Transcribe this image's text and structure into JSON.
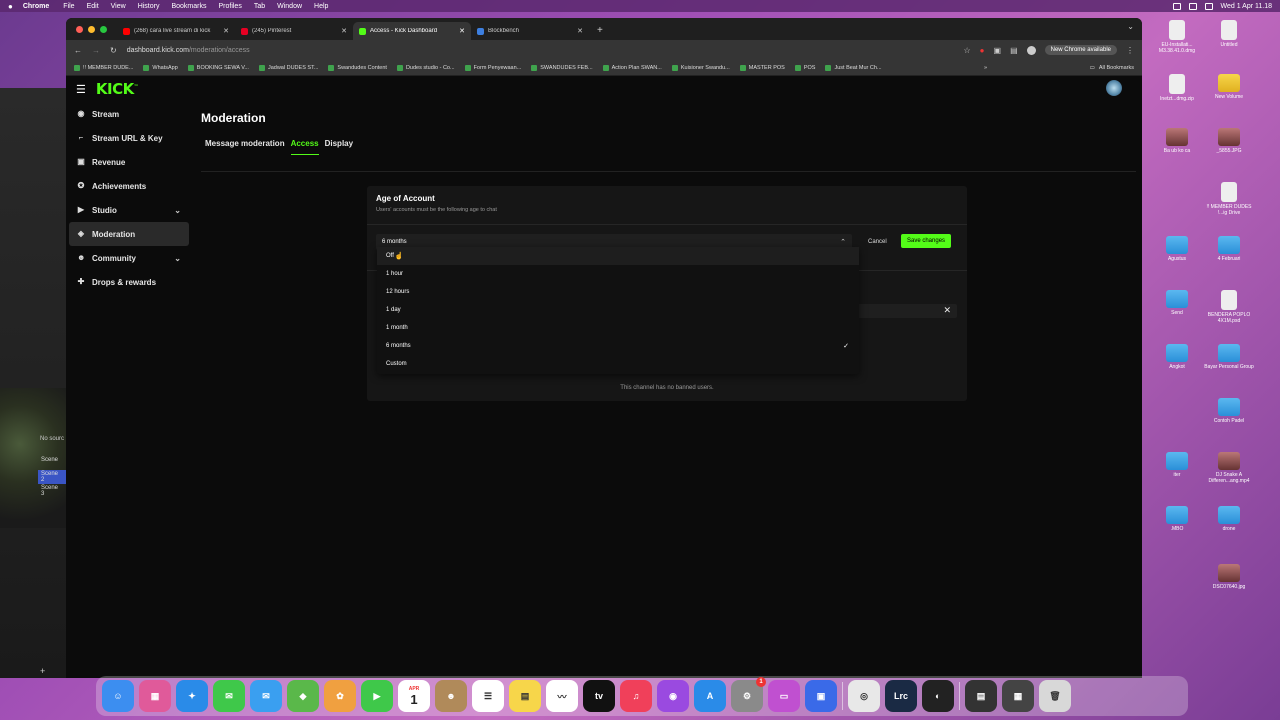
{
  "menubar": {
    "app_name": "Chrome",
    "items": [
      "File",
      "Edit",
      "View",
      "History",
      "Bookmarks",
      "Profiles",
      "Tab",
      "Window",
      "Help"
    ],
    "datetime": "Wed 1 Apr 11.18"
  },
  "obs": {
    "no_source": "No sourc",
    "scenes": [
      "Scene",
      "Scene 2",
      "Scene 3"
    ]
  },
  "browser": {
    "tabs": [
      {
        "title": "(268) cara live stream di kick",
        "color": "#ff0000"
      },
      {
        "title": "(245) Pinterest",
        "color": "#e60023"
      },
      {
        "title": "Access - Kick Dashboard",
        "color": "#53fc18"
      },
      {
        "title": "Blockbench",
        "color": "#3d7fe0"
      }
    ],
    "url_host": "dashboard.kick.com",
    "url_path": "/moderation/access",
    "update_label": "New Chrome available",
    "bookmarks": [
      "!! MEMBER DUDE...",
      "WhatsApp",
      "BOOKING SEWA V...",
      "Jadwal DUDES ST...",
      "Swandudes Content",
      "Dudes studio - Co...",
      "Form Penyewaan...",
      "SWANDUDES FEB...",
      "Action Plan SWAN...",
      "Kuisioner Swandu...",
      "MASTER POS",
      "POS",
      "Just Beat Mur Ch..."
    ],
    "all_bookmarks": "All Bookmarks"
  },
  "kick": {
    "logo": "KICK",
    "sidebar": [
      {
        "label": "Stream",
        "icon": "stream-icon",
        "chevron": false
      },
      {
        "label": "Stream URL & Key",
        "icon": "key-icon",
        "chevron": false
      },
      {
        "label": "Revenue",
        "icon": "revenue-icon",
        "chevron": false
      },
      {
        "label": "Achievements",
        "icon": "trophy-icon",
        "chevron": false
      },
      {
        "label": "Studio",
        "icon": "studio-icon",
        "chevron": true
      },
      {
        "label": "Moderation",
        "icon": "shield-icon",
        "chevron": false,
        "active": true
      },
      {
        "label": "Community",
        "icon": "community-icon",
        "chevron": true
      },
      {
        "label": "Drops & rewards",
        "icon": "gift-icon",
        "chevron": false
      }
    ],
    "page_title": "Moderation",
    "tabs": [
      {
        "label": "Message moderation",
        "active": false
      },
      {
        "label": "Access",
        "active": true
      },
      {
        "label": "Display",
        "active": false
      }
    ],
    "card": {
      "title": "Age of Account",
      "subtitle": "Users' accounts must be the following age to chat",
      "selected_value": "6 months",
      "cancel_label": "Cancel",
      "save_label": "Save changes",
      "empty_text": "This channel has no banned users."
    },
    "dropdown_options": [
      {
        "label": "Off",
        "hover": true,
        "selected": false
      },
      {
        "label": "1 hour",
        "hover": false,
        "selected": false
      },
      {
        "label": "12 hours",
        "hover": false,
        "selected": false
      },
      {
        "label": "1 day",
        "hover": false,
        "selected": false
      },
      {
        "label": "1 month",
        "hover": false,
        "selected": false
      },
      {
        "label": "6 months",
        "hover": false,
        "selected": true
      },
      {
        "label": "Custom",
        "hover": false,
        "selected": false
      }
    ],
    "accent_color": "#53fc18"
  },
  "desktop_icons": [
    {
      "label": "EU-Installati... M3.38.41.0.dmg",
      "type": "file"
    },
    {
      "label": "Untitled",
      "type": "file"
    },
    {
      "label": "New Volume",
      "type": "yellow"
    },
    {
      "label": "Inetzt...dmg.zip",
      "type": "file"
    },
    {
      "label": "_5855.JPG",
      "type": "img"
    },
    {
      "label": "Ba ub ko ca",
      "type": "img"
    },
    {
      "label": "!! MEMBER DUDES !...ig Drive",
      "type": "file"
    },
    {
      "label": "Agustus",
      "type": "folder"
    },
    {
      "label": "4 Februari",
      "type": "folder"
    },
    {
      "label": "Send",
      "type": "folder"
    },
    {
      "label": "BENDERA POPLO 4X1M.psd",
      "type": "file"
    },
    {
      "label": "Angkot",
      "type": "folder"
    },
    {
      "label": "Bayar Personal Group",
      "type": "folder"
    },
    {
      "label": "Contoh Padel",
      "type": "folder"
    },
    {
      "label": "iter",
      "type": "folder"
    },
    {
      "label": "DJ Snake A Differen...ang.mp4",
      "type": "img"
    },
    {
      "label": ".MBO",
      "type": "folder"
    },
    {
      "label": "drone",
      "type": "folder"
    },
    {
      "label": "DSC07640.jpg",
      "type": "img"
    }
  ],
  "dock": [
    {
      "name": "finder-icon",
      "color": "#3c8ef0",
      "glyph": "☺"
    },
    {
      "name": "launchpad-icon",
      "color": "#e05a9a",
      "glyph": "▦"
    },
    {
      "name": "safari-icon",
      "color": "#2a8be8",
      "glyph": "✦"
    },
    {
      "name": "messages-icon",
      "color": "#3fc84a",
      "glyph": "✉"
    },
    {
      "name": "mail-icon",
      "color": "#3a9ff0",
      "glyph": "✉"
    },
    {
      "name": "maps-icon",
      "color": "#5ab84a",
      "glyph": "◆"
    },
    {
      "name": "photos-icon",
      "color": "#f0a040",
      "glyph": "✿"
    },
    {
      "name": "facetime-icon",
      "color": "#3fc84a",
      "glyph": "▶"
    },
    {
      "name": "calendar-icon",
      "color": "#ffffff",
      "glyph": "1"
    },
    {
      "name": "contacts-icon",
      "color": "#b08a5a",
      "glyph": "☻"
    },
    {
      "name": "reminders-icon",
      "color": "#ffffff",
      "glyph": "☰"
    },
    {
      "name": "notes-icon",
      "color": "#f7d64a",
      "glyph": "▤"
    },
    {
      "name": "freeform-icon",
      "color": "#ffffff",
      "glyph": "〰"
    },
    {
      "name": "appletv-icon",
      "color": "#111111",
      "glyph": "tv"
    },
    {
      "name": "music-icon",
      "color": "#f0405a",
      "glyph": "♫"
    },
    {
      "name": "podcasts-icon",
      "color": "#9a4ae0",
      "glyph": "◉"
    },
    {
      "name": "appstore-icon",
      "color": "#2a8be8",
      "glyph": "A"
    },
    {
      "name": "settings-icon",
      "color": "#8a8a8a",
      "glyph": "⚙"
    },
    {
      "name": "iphone-mirroring-icon",
      "color": "#c050d0",
      "glyph": "▭"
    },
    {
      "name": "app-icon",
      "color": "#3a6ae8",
      "glyph": "▣"
    },
    {
      "name": "chrome-icon",
      "color": "#e8e8e8",
      "glyph": "◎"
    },
    {
      "name": "lightroom-icon",
      "color": "#1a2a44",
      "glyph": "Lrc"
    },
    {
      "name": "obs-icon",
      "color": "#222222",
      "glyph": "◐"
    },
    {
      "name": "downloads-icon",
      "color": "#333333",
      "glyph": "▤"
    },
    {
      "name": "recent-window-icon",
      "color": "#444444",
      "glyph": "▦"
    },
    {
      "name": "trash-icon",
      "color": "#d8d8d8",
      "glyph": "🗑"
    }
  ],
  "dock_badge": "1",
  "calendar_month": "APR"
}
